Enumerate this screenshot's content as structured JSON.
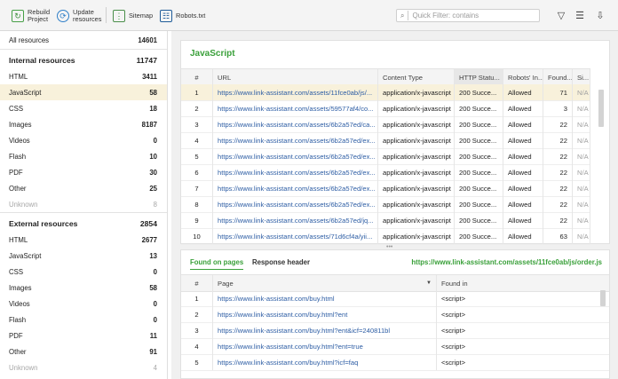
{
  "toolbar": {
    "rebuild": "Rebuild\nProject",
    "update": "Update\nresources",
    "sitemap": "Sitemap",
    "robots": "Robots.txt",
    "search_placeholder": "Quick Filter: contains"
  },
  "sidebar": {
    "all": {
      "label": "All resources",
      "count": "14601"
    },
    "internal": {
      "label": "Internal resources",
      "count": "11747"
    },
    "internal_items": [
      {
        "label": "HTML",
        "count": "3411"
      },
      {
        "label": "JavaScript",
        "count": "58"
      },
      {
        "label": "CSS",
        "count": "18"
      },
      {
        "label": "Images",
        "count": "8187"
      },
      {
        "label": "Videos",
        "count": "0"
      },
      {
        "label": "Flash",
        "count": "10"
      },
      {
        "label": "PDF",
        "count": "30"
      },
      {
        "label": "Other",
        "count": "25"
      },
      {
        "label": "Unknown",
        "count": "8"
      }
    ],
    "external": {
      "label": "External resources",
      "count": "2854"
    },
    "external_items": [
      {
        "label": "HTML",
        "count": "2677"
      },
      {
        "label": "JavaScript",
        "count": "13"
      },
      {
        "label": "CSS",
        "count": "0"
      },
      {
        "label": "Images",
        "count": "58"
      },
      {
        "label": "Videos",
        "count": "0"
      },
      {
        "label": "Flash",
        "count": "0"
      },
      {
        "label": "PDF",
        "count": "11"
      },
      {
        "label": "Other",
        "count": "91"
      },
      {
        "label": "Unknown",
        "count": "4"
      }
    ]
  },
  "main": {
    "title": "JavaScript",
    "columns": [
      "#",
      "URL",
      "Content Type",
      "HTTP Statu...",
      "Robots' In...",
      "Found...",
      "Si..."
    ],
    "rows": [
      {
        "n": "1",
        "url": "https://www.link-assistant.com/assets/11fce0ab/js/...",
        "type": "application/x-javascript",
        "status": "200 Succe...",
        "robots": "Allowed",
        "found": "71",
        "size": "N/A"
      },
      {
        "n": "2",
        "url": "https://www.link-assistant.com/assets/59577af4/co...",
        "type": "application/x-javascript",
        "status": "200 Succe...",
        "robots": "Allowed",
        "found": "3",
        "size": "N/A"
      },
      {
        "n": "3",
        "url": "https://www.link-assistant.com/assets/6b2a57ed/ca...",
        "type": "application/x-javascript",
        "status": "200 Succe...",
        "robots": "Allowed",
        "found": "22",
        "size": "N/A"
      },
      {
        "n": "4",
        "url": "https://www.link-assistant.com/assets/6b2a57ed/ex...",
        "type": "application/x-javascript",
        "status": "200 Succe...",
        "robots": "Allowed",
        "found": "22",
        "size": "N/A"
      },
      {
        "n": "5",
        "url": "https://www.link-assistant.com/assets/6b2a57ed/ex...",
        "type": "application/x-javascript",
        "status": "200 Succe...",
        "robots": "Allowed",
        "found": "22",
        "size": "N/A"
      },
      {
        "n": "6",
        "url": "https://www.link-assistant.com/assets/6b2a57ed/ex...",
        "type": "application/x-javascript",
        "status": "200 Succe...",
        "robots": "Allowed",
        "found": "22",
        "size": "N/A"
      },
      {
        "n": "7",
        "url": "https://www.link-assistant.com/assets/6b2a57ed/ex...",
        "type": "application/x-javascript",
        "status": "200 Succe...",
        "robots": "Allowed",
        "found": "22",
        "size": "N/A"
      },
      {
        "n": "8",
        "url": "https://www.link-assistant.com/assets/6b2a57ed/ex...",
        "type": "application/x-javascript",
        "status": "200 Succe...",
        "robots": "Allowed",
        "found": "22",
        "size": "N/A"
      },
      {
        "n": "9",
        "url": "https://www.link-assistant.com/assets/6b2a57ed/jq...",
        "type": "application/x-javascript",
        "status": "200 Succe...",
        "robots": "Allowed",
        "found": "22",
        "size": "N/A"
      },
      {
        "n": "10",
        "url": "https://www.link-assistant.com/assets/71d6cf4a/yii...",
        "type": "application/x-javascript",
        "status": "200 Succe...",
        "robots": "Allowed",
        "found": "63",
        "size": "N/A"
      }
    ]
  },
  "bottom": {
    "tab_found": "Found on pages",
    "tab_response": "Response header",
    "selected_url": "https://www.link-assistant.com/assets/11fce0ab/js/order.js",
    "columns": [
      "#",
      "Page",
      "Found in"
    ],
    "rows": [
      {
        "n": "1",
        "page": "https://www.link-assistant.com/buy.html",
        "found": "<script>"
      },
      {
        "n": "2",
        "page": "https://www.link-assistant.com/buy.html?ent",
        "found": "<script>"
      },
      {
        "n": "3",
        "page": "https://www.link-assistant.com/buy.html?ent&icf=240811bl",
        "found": "<script>"
      },
      {
        "n": "4",
        "page": "https://www.link-assistant.com/buy.html?ent=true",
        "found": "<script>"
      },
      {
        "n": "5",
        "page": "https://www.link-assistant.com/buy.html?icf=faq",
        "found": "<script>"
      }
    ]
  }
}
